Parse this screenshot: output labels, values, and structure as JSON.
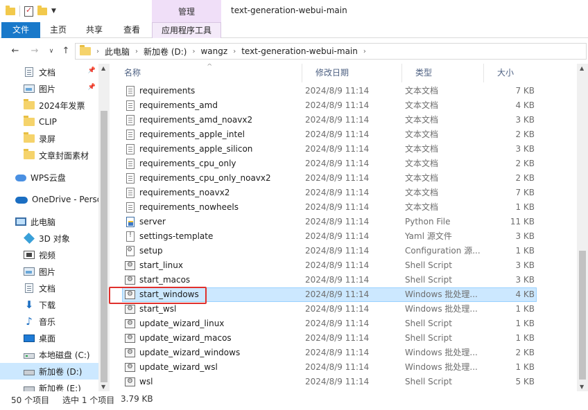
{
  "window": {
    "title": "text-generation-webui-main",
    "manage_tab": "管理"
  },
  "ribbon": {
    "tabs": [
      "文件",
      "主页",
      "共享",
      "查看",
      "应用程序工具"
    ]
  },
  "address": {
    "crumbs": [
      "此电脑",
      "新加卷 (D:)",
      "wangz",
      "text-generation-webui-main"
    ]
  },
  "nav": {
    "items": [
      {
        "label": "文档",
        "icon": "document-icon",
        "pinned": true
      },
      {
        "label": "图片",
        "icon": "pictures-icon",
        "pinned": true
      },
      {
        "label": "2024年发票",
        "icon": "folder-icon"
      },
      {
        "label": "CLIP",
        "icon": "folder-icon"
      },
      {
        "label": "录屏",
        "icon": "folder-icon"
      },
      {
        "label": "文章封面素材",
        "icon": "folder-icon"
      },
      {
        "label": "WPS云盘",
        "icon": "cloud-icon"
      },
      {
        "label": "OneDrive - Personal",
        "icon": "onedrive-icon"
      },
      {
        "label": "此电脑",
        "icon": "this-pc-icon"
      },
      {
        "label": "3D 对象",
        "icon": "3d-objects-icon"
      },
      {
        "label": "视频",
        "icon": "videos-icon"
      },
      {
        "label": "图片",
        "icon": "pictures-icon"
      },
      {
        "label": "文档",
        "icon": "document-icon"
      },
      {
        "label": "下载",
        "icon": "downloads-icon"
      },
      {
        "label": "音乐",
        "icon": "music-icon"
      },
      {
        "label": "桌面",
        "icon": "desktop-icon"
      },
      {
        "label": "本地磁盘 (C:)",
        "icon": "drive-c-icon"
      },
      {
        "label": "新加卷 (D:)",
        "icon": "drive-d-icon",
        "selected": true
      },
      {
        "label": "新加卷 (E:)",
        "icon": "drive-e-icon"
      }
    ]
  },
  "columns": {
    "name": "名称",
    "date": "修改日期",
    "type": "类型",
    "size": "大小"
  },
  "files": [
    {
      "name": "requirements",
      "date": "2024/8/9 11:14",
      "type": "文本文档",
      "size": "7 KB",
      "icon": "txt"
    },
    {
      "name": "requirements_amd",
      "date": "2024/8/9 11:14",
      "type": "文本文档",
      "size": "4 KB",
      "icon": "txt"
    },
    {
      "name": "requirements_amd_noavx2",
      "date": "2024/8/9 11:14",
      "type": "文本文档",
      "size": "3 KB",
      "icon": "txt"
    },
    {
      "name": "requirements_apple_intel",
      "date": "2024/8/9 11:14",
      "type": "文本文档",
      "size": "2 KB",
      "icon": "txt"
    },
    {
      "name": "requirements_apple_silicon",
      "date": "2024/8/9 11:14",
      "type": "文本文档",
      "size": "3 KB",
      "icon": "txt"
    },
    {
      "name": "requirements_cpu_only",
      "date": "2024/8/9 11:14",
      "type": "文本文档",
      "size": "2 KB",
      "icon": "txt"
    },
    {
      "name": "requirements_cpu_only_noavx2",
      "date": "2024/8/9 11:14",
      "type": "文本文档",
      "size": "2 KB",
      "icon": "txt"
    },
    {
      "name": "requirements_noavx2",
      "date": "2024/8/9 11:14",
      "type": "文本文档",
      "size": "7 KB",
      "icon": "txt"
    },
    {
      "name": "requirements_nowheels",
      "date": "2024/8/9 11:14",
      "type": "文本文档",
      "size": "1 KB",
      "icon": "txt"
    },
    {
      "name": "server",
      "date": "2024/8/9 11:14",
      "type": "Python File",
      "size": "11 KB",
      "icon": "py"
    },
    {
      "name": "settings-template",
      "date": "2024/8/9 11:14",
      "type": "Yaml 源文件",
      "size": "3 KB",
      "icon": "yaml"
    },
    {
      "name": "setup",
      "date": "2024/8/9 11:14",
      "type": "Configuration 源...",
      "size": "1 KB",
      "icon": "cfg"
    },
    {
      "name": "start_linux",
      "date": "2024/8/9 11:14",
      "type": "Shell Script",
      "size": "3 KB",
      "icon": "script"
    },
    {
      "name": "start_macos",
      "date": "2024/8/9 11:14",
      "type": "Shell Script",
      "size": "3 KB",
      "icon": "script"
    },
    {
      "name": "start_windows",
      "date": "2024/8/9 11:14",
      "type": "Windows 批处理...",
      "size": "4 KB",
      "icon": "script",
      "selected": true
    },
    {
      "name": "start_wsl",
      "date": "2024/8/9 11:14",
      "type": "Windows 批处理...",
      "size": "1 KB",
      "icon": "script"
    },
    {
      "name": "update_wizard_linux",
      "date": "2024/8/9 11:14",
      "type": "Shell Script",
      "size": "1 KB",
      "icon": "script"
    },
    {
      "name": "update_wizard_macos",
      "date": "2024/8/9 11:14",
      "type": "Shell Script",
      "size": "1 KB",
      "icon": "script"
    },
    {
      "name": "update_wizard_windows",
      "date": "2024/8/9 11:14",
      "type": "Windows 批处理...",
      "size": "2 KB",
      "icon": "script"
    },
    {
      "name": "update_wizard_wsl",
      "date": "2024/8/9 11:14",
      "type": "Windows 批处理...",
      "size": "1 KB",
      "icon": "script"
    },
    {
      "name": "wsl",
      "date": "2024/8/9 11:14",
      "type": "Shell Script",
      "size": "5 KB",
      "icon": "script"
    }
  ],
  "status": {
    "count": "50 个项目",
    "selected": "选中 1 个项目",
    "size": "3.79 KB"
  },
  "colors": {
    "accent": "#1979ca",
    "selection": "#cce8ff",
    "highlight_box": "#e0302c",
    "manage_tab": "#f0dff8"
  }
}
